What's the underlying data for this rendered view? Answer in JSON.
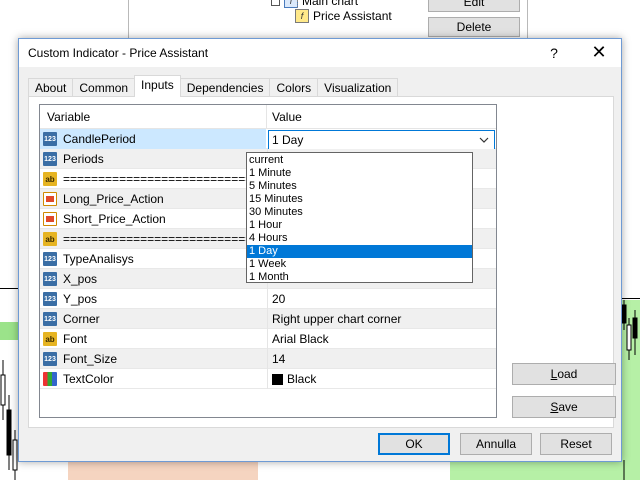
{
  "background": {
    "tree_parent_label": "Main chart",
    "tree_item_label": "Price Assistant",
    "edit_button": "Edit",
    "delete_button": "Delete",
    "chart_green": "#b6f0a6",
    "chart_peach": "#f5d4c0"
  },
  "dialog": {
    "title": "Custom Indicator - Price Assistant",
    "help_label": "?",
    "close_label": "✕",
    "tabs": [
      {
        "label": "About"
      },
      {
        "label": "Common"
      },
      {
        "label": "Inputs"
      },
      {
        "label": "Dependencies"
      },
      {
        "label": "Colors"
      },
      {
        "label": "Visualization"
      }
    ],
    "active_tab": "Inputs",
    "grid": {
      "col_variable": "Variable",
      "col_value": "Value",
      "rows": [
        {
          "icon": "int-icon",
          "variable": "CandlePeriod",
          "value": "1 Day"
        },
        {
          "icon": "int-icon",
          "variable": "Periods",
          "value": ""
        },
        {
          "icon": "string-icon",
          "variable": "================================",
          "value": ""
        },
        {
          "icon": "bool-icon",
          "variable": "Long_Price_Action",
          "value": ""
        },
        {
          "icon": "bool-icon",
          "variable": "Short_Price_Action",
          "value": ""
        },
        {
          "icon": "string-icon",
          "variable": "================================",
          "value": ""
        },
        {
          "icon": "int-icon",
          "variable": "TypeAnalisys",
          "value": ""
        },
        {
          "icon": "int-icon",
          "variable": "X_pos",
          "value": ""
        },
        {
          "icon": "int-icon",
          "variable": "Y_pos",
          "value": "20"
        },
        {
          "icon": "int-icon",
          "variable": "Corner",
          "value": "Right upper chart corner"
        },
        {
          "icon": "string-icon",
          "variable": "Font",
          "value": "Arial Black"
        },
        {
          "icon": "int-icon",
          "variable": "Font_Size",
          "value": "14"
        },
        {
          "icon": "color-icon",
          "variable": "TextColor",
          "value": "Black",
          "swatch": "#000000"
        }
      ]
    },
    "dropdown": {
      "selected": "1 Day",
      "options": [
        "current",
        "1 Minute",
        "5 Minutes",
        "15 Minutes",
        "30 Minutes",
        "1 Hour",
        "4 Hours",
        "1 Day",
        "1 Week",
        "1 Month"
      ]
    },
    "load_button": {
      "prefix": "",
      "underlined": "L",
      "rest": "oad"
    },
    "save_button": {
      "prefix": "",
      "underlined": "S",
      "rest": "ave"
    },
    "ok_button": "OK",
    "cancel_button": "Annulla",
    "reset_button": "Reset",
    "colors": {
      "accent": "#0078d7",
      "selection": "#cce8ff"
    }
  }
}
